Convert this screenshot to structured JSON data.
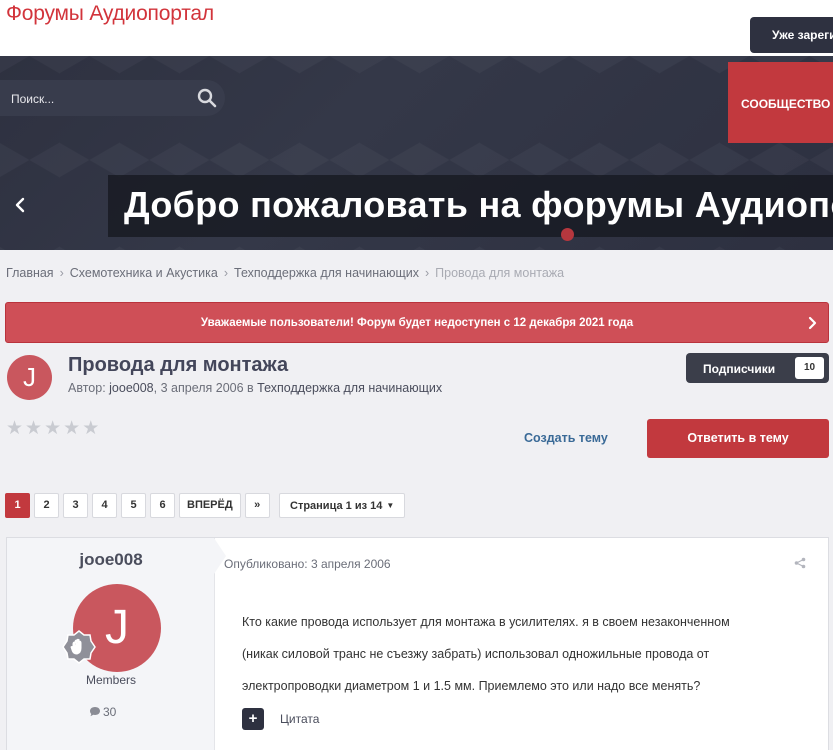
{
  "site": {
    "title": "Форумы Аудиопортал",
    "signin_label": "Уже зарегистрированы? Войти"
  },
  "header": {
    "search_placeholder": "Поиск...",
    "nav_community": "СООБЩЕСТВО",
    "welcome_text": "Добро пожаловать на форумы Аудиопортал"
  },
  "breadcrumb": [
    "Главная",
    "Схемотехника и Акустика",
    "Техподдержка для начинающих",
    "Провода для монтажа"
  ],
  "notice": {
    "text": "Уважаемые пользователи! Форум будет недоступен с 12 декабря 2021 года"
  },
  "topic": {
    "avatar_letter": "J",
    "title": "Провода для монтажа",
    "meta_prefix": "Автор: ",
    "author": "jooe008",
    "date": "3 апреля 2006",
    "meta_in": " в ",
    "forum": "Техподдержка для начинающих",
    "followers_label": "Подписчики",
    "followers_count": "10",
    "create_topic": "Создать тему",
    "reply": "Ответить в тему"
  },
  "pagination": {
    "pages": [
      "1",
      "2",
      "3",
      "4",
      "5",
      "6"
    ],
    "next": "ВПЕРЁД",
    "last": "»",
    "page_jump": "Страница 1 из 14"
  },
  "post": {
    "author": "jooe008",
    "avatar_letter": "J",
    "group": "Members",
    "post_count": "30",
    "published": "Опубликовано: 3 апреля 2006",
    "body_lines": [
      "Кто какие провода использует для монтажа в усилителях. я в своем незаконченном",
      "(никак силовой транс не съезжу забрать) использовал одножильные провода от",
      "электропроводки диаметром 1 и 1.5 мм. Приемлемо это или надо все менять?"
    ],
    "quote_label": "Цитата"
  },
  "colors": {
    "brand_red": "#c2393e",
    "header_dark": "#2e3140",
    "notice_red": "#cf4f57"
  }
}
